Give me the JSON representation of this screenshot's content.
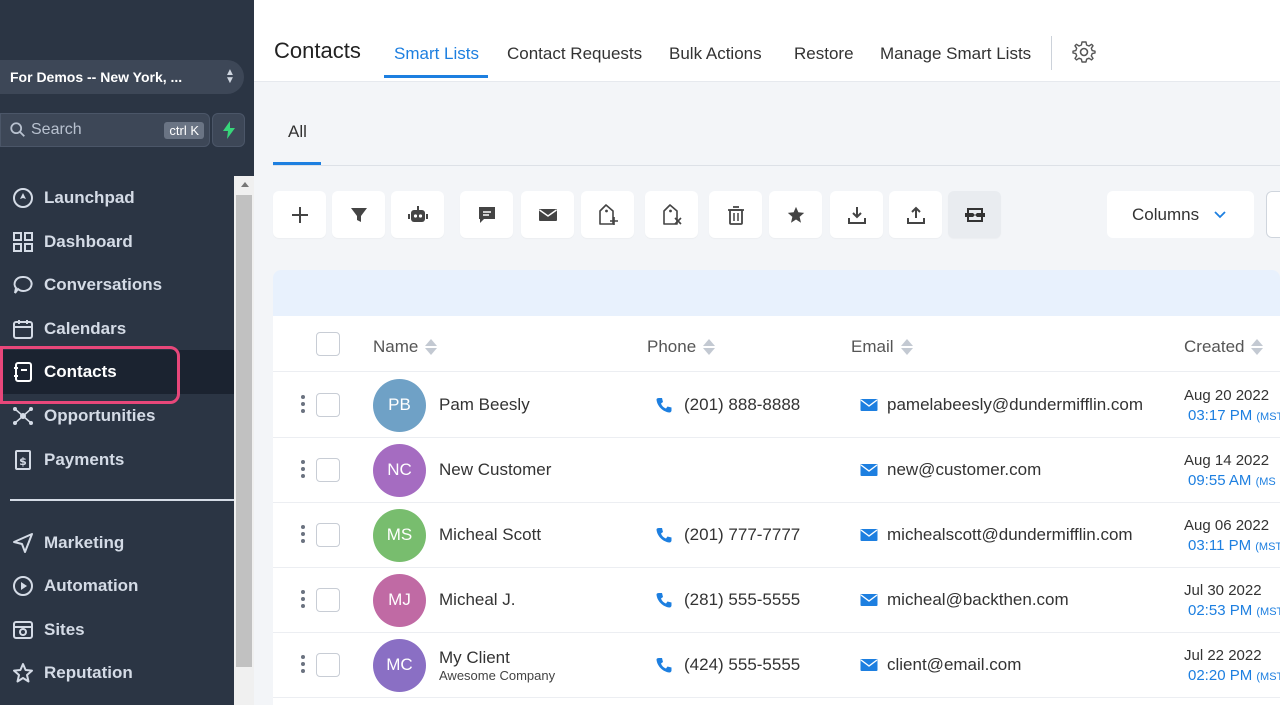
{
  "sidebar": {
    "account": "For Demos -- New York, ...",
    "search_placeholder": "Search",
    "search_shortcut": "ctrl K",
    "nav": [
      {
        "label": "Launchpad",
        "icon": "rocket-icon"
      },
      {
        "label": "Dashboard",
        "icon": "grid-icon"
      },
      {
        "label": "Conversations",
        "icon": "chat-bubble-icon"
      },
      {
        "label": "Calendars",
        "icon": "calendar-icon"
      },
      {
        "label": "Contacts",
        "icon": "contact-book-icon",
        "active": true
      },
      {
        "label": "Opportunities",
        "icon": "network-icon"
      },
      {
        "label": "Payments",
        "icon": "dollar-receipt-icon"
      },
      {
        "label": "Marketing",
        "icon": "paper-plane-icon"
      },
      {
        "label": "Automation",
        "icon": "play-circle-icon"
      },
      {
        "label": "Sites",
        "icon": "browser-icon"
      },
      {
        "label": "Reputation",
        "icon": "star-outline-icon"
      }
    ]
  },
  "header": {
    "title": "Contacts",
    "tabs": [
      "Smart Lists",
      "Contact Requests",
      "Bulk Actions",
      "Restore",
      "Manage Smart Lists"
    ],
    "active_tab": "Smart Lists"
  },
  "subtabs": {
    "all": "All"
  },
  "toolbar": {
    "buttons": [
      "add-icon",
      "filter-icon",
      "robot-icon",
      "message-icon",
      "email-icon",
      "add-tag-icon",
      "remove-tag-icon",
      "trash-icon",
      "star-icon",
      "download-icon",
      "upload-icon",
      "merge-icon"
    ],
    "columns_label": "Columns"
  },
  "table": {
    "headers": {
      "name": "Name",
      "phone": "Phone",
      "email": "Email",
      "created": "Created"
    },
    "rows": [
      {
        "initials": "PB",
        "color": "#6fa1c6",
        "name": "Pam Beesly",
        "company": "",
        "phone": "(201) 888-8888",
        "email": "pamelabeesly@dundermifflin.com",
        "date": "Aug 20 2022",
        "time": "03:17 PM",
        "tz": "(MST"
      },
      {
        "initials": "NC",
        "color": "#a56cc1",
        "name": "New Customer",
        "company": "",
        "phone": "",
        "email": "new@customer.com",
        "date": "Aug 14 2022",
        "time": "09:55 AM",
        "tz": "(MS"
      },
      {
        "initials": "MS",
        "color": "#78bd6e",
        "name": "Micheal Scott",
        "company": "",
        "phone": "(201) 777-7777",
        "email": "michealscott@dundermifflin.com",
        "date": "Aug 06 2022",
        "time": "03:11 PM",
        "tz": "(MST"
      },
      {
        "initials": "MJ",
        "color": "#c06aa4",
        "name": "Micheal J.",
        "company": "",
        "phone": "(281) 555-5555",
        "email": "micheal@backthen.com",
        "date": "Jul 30 2022",
        "time": "02:53 PM",
        "tz": "(MST"
      },
      {
        "initials": "MC",
        "color": "#8a6fc4",
        "name": "My Client",
        "company": "Awesome Company",
        "phone": "(424) 555-5555",
        "email": "client@email.com",
        "date": "Jul 22 2022",
        "time": "02:20 PM",
        "tz": "(MST"
      }
    ]
  },
  "colors": {
    "sidebar_bg": "#2b3544",
    "accent": "#1d7fe0",
    "highlight": "#e8477a"
  }
}
